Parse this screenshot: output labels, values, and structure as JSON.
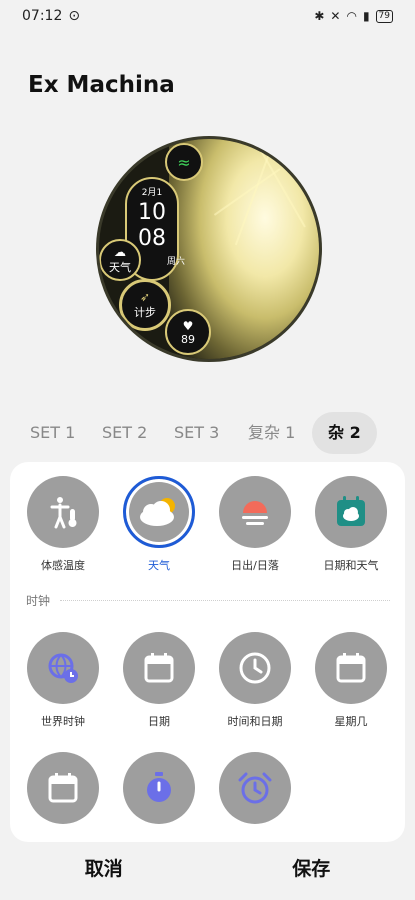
{
  "status": {
    "time": "07:12",
    "battery": "79"
  },
  "title": "Ex Machina",
  "watch": {
    "date": "2月1",
    "hour": "10",
    "minute": "08",
    "weekday": "周六",
    "weather_label": "天气",
    "steps_label": "计步",
    "heart_value": "89"
  },
  "tabs": [
    {
      "label": "SET 1"
    },
    {
      "label": "SET 2"
    },
    {
      "label": "SET 3"
    },
    {
      "label": "复杂 1"
    },
    {
      "label": "杂 2"
    }
  ],
  "grid": {
    "row1": [
      {
        "label": "体感温度",
        "icon": "feels-like-temperature-icon"
      },
      {
        "label": "天气",
        "icon": "weather-icon",
        "selected": true
      },
      {
        "label": "日出/日落",
        "icon": "sunrise-sunset-icon"
      },
      {
        "label": "日期和天气",
        "icon": "date-weather-icon"
      }
    ],
    "section": "时钟",
    "row2": [
      {
        "label": "世界时钟",
        "icon": "world-clock-icon"
      },
      {
        "label": "日期",
        "icon": "calendar-icon"
      },
      {
        "label": "时间和日期",
        "icon": "clock-icon"
      },
      {
        "label": "星期几",
        "icon": "weekday-calendar-icon"
      }
    ],
    "row3_icons": [
      "calendar-icon",
      "stopwatch-icon",
      "alarm-icon"
    ]
  },
  "actions": {
    "cancel": "取消",
    "save": "保存"
  },
  "colors": {
    "accent": "#1e5bd6",
    "icon_gray": "#9e9e9e",
    "watch_gold": "#d9c977"
  }
}
